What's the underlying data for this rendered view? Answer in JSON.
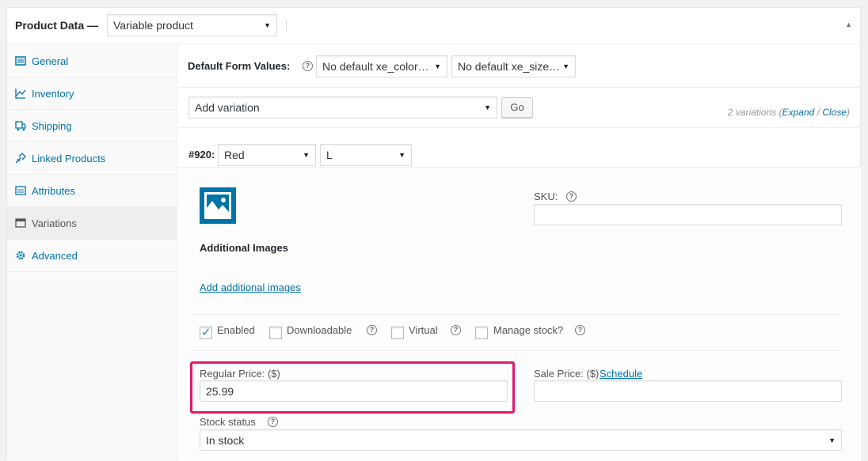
{
  "header": {
    "title": "Product Data —",
    "product_type": "Variable product",
    "toggle_icon": "triangle-up-icon"
  },
  "sidebar": {
    "items": [
      {
        "label": "General",
        "icon": "wrench-icon",
        "active": false
      },
      {
        "label": "Inventory",
        "icon": "chart-icon",
        "active": false
      },
      {
        "label": "Shipping",
        "icon": "truck-icon",
        "active": false
      },
      {
        "label": "Linked Products",
        "icon": "link-icon",
        "active": false
      },
      {
        "label": "Attributes",
        "icon": "list-icon",
        "active": false
      },
      {
        "label": "Variations",
        "icon": "window-icon",
        "active": true
      },
      {
        "label": "Advanced",
        "icon": "gear-icon",
        "active": false
      }
    ]
  },
  "defaults": {
    "label": "Default Form Values:",
    "color_select": "No default xe_color…",
    "size_select": "No default xe_size…"
  },
  "add_variation": {
    "select_value": "Add variation",
    "go_label": "Go",
    "count_text": "2 variations (",
    "expand_label": "Expand",
    "slash": " / ",
    "close_label": "Close",
    "close_paren": ")"
  },
  "variation": {
    "id_label": "#920:",
    "color_value": "Red",
    "size_value": "L",
    "additional_images_label": "Additional Images",
    "add_images_link": "Add additional images",
    "sku_label": "SKU:",
    "sku_value": "",
    "options": {
      "enabled": {
        "label": "Enabled",
        "checked": true
      },
      "downloadable": {
        "label": "Downloadable",
        "checked": false
      },
      "virtual": {
        "label": "Virtual",
        "checked": false
      },
      "manage_stock": {
        "label": "Manage stock?",
        "checked": false
      }
    },
    "regular_price_label": "Regular Price: ($)",
    "regular_price_value": "25.99",
    "sale_price_label": "Sale Price: ($)",
    "schedule_link": "Schedule",
    "sale_price_value": "",
    "stock_status_label": "Stock status",
    "stock_status_value": "In stock"
  },
  "colors": {
    "link": "#0073aa",
    "highlight": "#e0196b",
    "image_icon": "#0073aa"
  },
  "help_glyph": "?",
  "arrow_glyph": "▼",
  "tick_glyph": "✓"
}
